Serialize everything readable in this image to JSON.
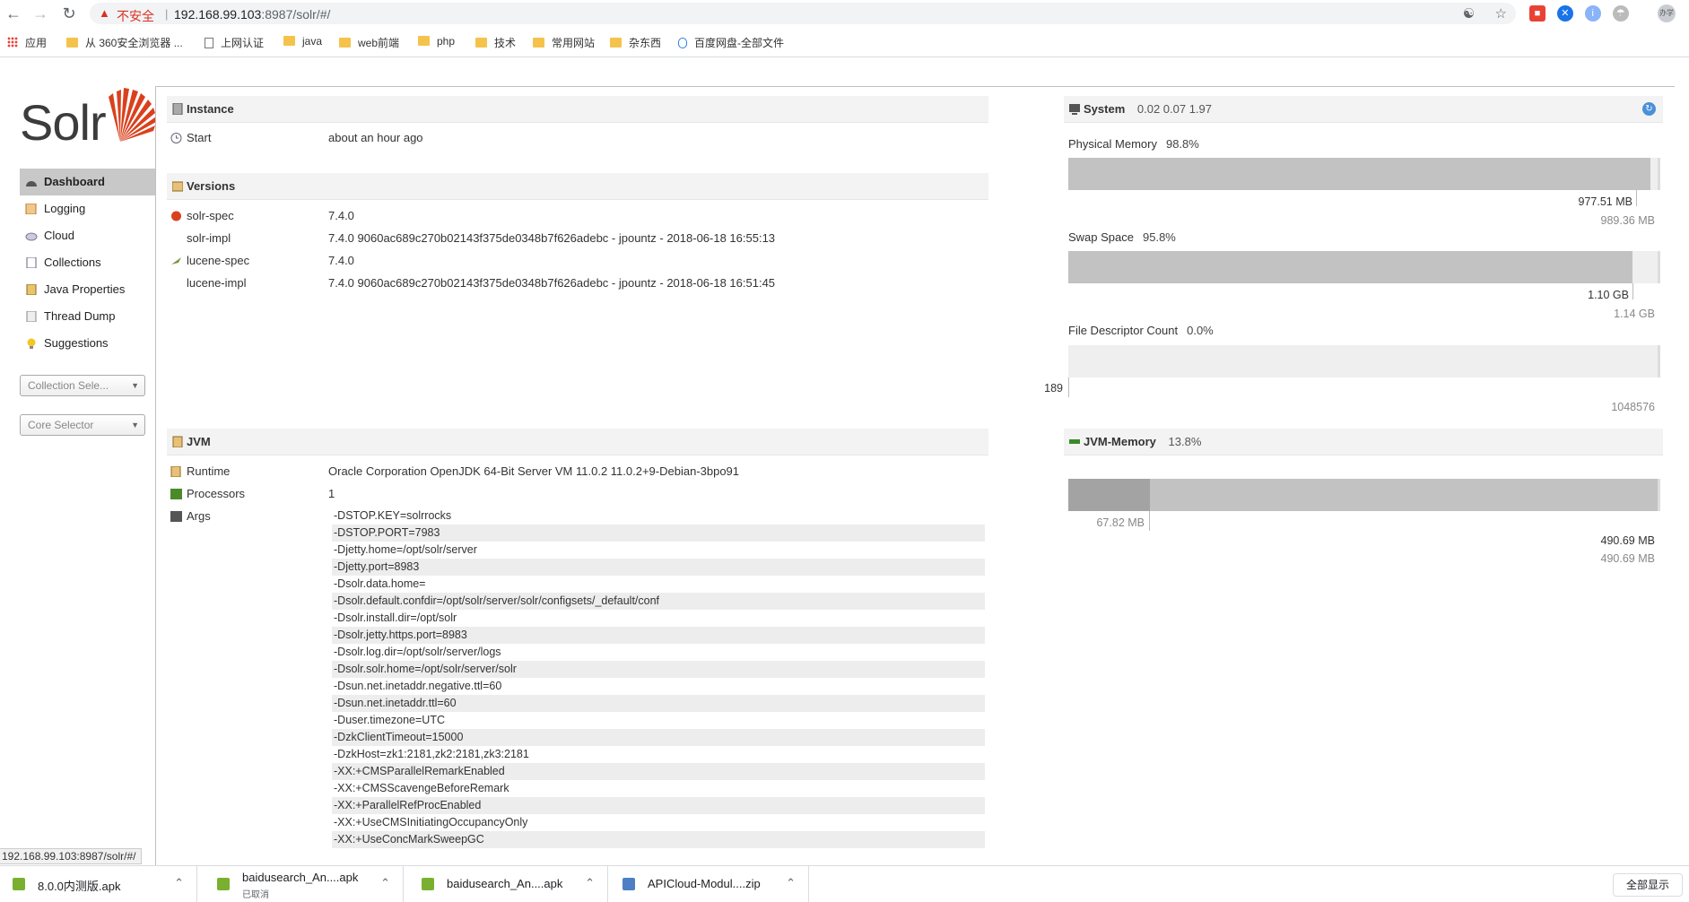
{
  "browser": {
    "insecure_label": "不安全",
    "url_host": "192.168.99.103",
    "url_rest": ":8987/solr/#/",
    "bookmarks": [
      "应用",
      "从 360安全浏览器 ...",
      "上网认证",
      "java",
      "web前端",
      "php",
      "技术",
      "常用网站",
      "杂东西",
      "百度网盘-全部文件"
    ],
    "profile_label": "办学"
  },
  "solr": {
    "logo_text": "Solr",
    "nav": [
      "Dashboard",
      "Logging",
      "Cloud",
      "Collections",
      "Java Properties",
      "Thread Dump",
      "Suggestions"
    ],
    "collection_selector": "Collection Sele...",
    "core_selector": "Core Selector"
  },
  "instance": {
    "title": "Instance",
    "start_label": "Start",
    "start_value": "about an hour ago"
  },
  "versions": {
    "title": "Versions",
    "rows": [
      {
        "k": "solr-spec",
        "v": "7.4.0"
      },
      {
        "k": "solr-impl",
        "v": "7.4.0 9060ac689c270b02143f375de0348b7f626adebc - jpountz - 2018-06-18 16:55:13"
      },
      {
        "k": "lucene-spec",
        "v": "7.4.0"
      },
      {
        "k": "lucene-impl",
        "v": "7.4.0 9060ac689c270b02143f375de0348b7f626adebc - jpountz - 2018-06-18 16:51:45"
      }
    ]
  },
  "jvm": {
    "title": "JVM",
    "runtime_label": "Runtime",
    "runtime_value": "Oracle Corporation OpenJDK 64-Bit Server VM 11.0.2 11.0.2+9-Debian-3bpo91",
    "processors_label": "Processors",
    "processors_value": "1",
    "args_label": "Args",
    "args": [
      "-DSTOP.KEY=solrrocks",
      "-DSTOP.PORT=7983",
      "-Djetty.home=/opt/solr/server",
      "-Djetty.port=8983",
      "-Dsolr.data.home=",
      "-Dsolr.default.confdir=/opt/solr/server/solr/configsets/_default/conf",
      "-Dsolr.install.dir=/opt/solr",
      "-Dsolr.jetty.https.port=8983",
      "-Dsolr.log.dir=/opt/solr/server/logs",
      "-Dsolr.solr.home=/opt/solr/server/solr",
      "-Dsun.net.inetaddr.negative.ttl=60",
      "-Dsun.net.inetaddr.ttl=60",
      "-Duser.timezone=UTC",
      "-DzkClientTimeout=15000",
      "-DzkHost=zk1:2181,zk2:2181,zk3:2181",
      "-XX:+CMSParallelRemarkEnabled",
      "-XX:+CMSScavengeBeforeRemark",
      "-XX:+ParallelRefProcEnabled",
      "-XX:+UseCMSInitiatingOccupancyOnly",
      "-XX:+UseConcMarkSweepGC"
    ]
  },
  "system": {
    "title": "System",
    "load": "0.02 0.07 1.97",
    "physical_memory": {
      "label": "Physical Memory",
      "pct": "98.8%",
      "used": "977.51 MB",
      "total": "989.36 MB",
      "fill": 0.988
    },
    "swap_space": {
      "label": "Swap Space",
      "pct": "95.8%",
      "used": "1.10 GB",
      "total": "1.14 GB",
      "fill": 0.958
    },
    "file_descriptor": {
      "label": "File Descriptor Count",
      "pct": "0.0%",
      "used": "189",
      "total": "1048576",
      "fill": 0.0
    }
  },
  "jvm_memory": {
    "title": "JVM-Memory",
    "pct": "13.8%",
    "used": "67.82 MB",
    "committed": "490.69 MB",
    "max": "490.69 MB",
    "used_fill": 0.138,
    "committed_fill": 1.0
  },
  "status_url": "192.168.99.103:8987/solr/#/",
  "downloads": [
    {
      "name": "8.0.0内测版.apk",
      "sub": ""
    },
    {
      "name": "baidusearch_An....apk",
      "sub": "已取消"
    },
    {
      "name": "baidusearch_An....apk",
      "sub": ""
    },
    {
      "name": "APICloud-Modul....zip",
      "sub": ""
    }
  ],
  "show_all": "全部显示"
}
